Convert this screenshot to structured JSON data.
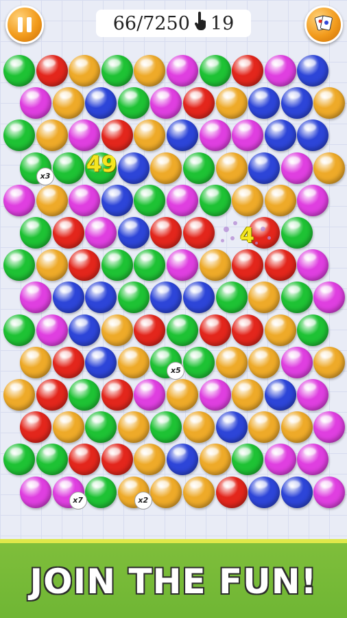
{
  "header": {
    "score": "66/7250",
    "moves": "19",
    "pause_icon": "pause-icon",
    "menu_icon": "cards-menu-icon",
    "hand_icon": "pointing-hand-icon"
  },
  "colors": {
    "G": "#1ec234",
    "R": "#e3261c",
    "O": "#eeaa29",
    "M": "#df3fe0",
    "B": "#2d45d8"
  },
  "board": {
    "rows": [
      "GROGOMGRMB",
      "MOBGMROBBO",
      "GOMROBMMBB",
      "GGGBOGOBMO",
      "MOMBGMGOOM",
      "GRMBRR.RG",
      "GORGGMORRM",
      "MBBGBBGOGM",
      "GMBORGRROG",
      "ORBOGGOOMO",
      "ORGRMOMOBM",
      "ROGOGOBOOM",
      "GGRROBOGMM",
      "MMGOOORBBM"
    ],
    "badges": [
      {
        "row": 3,
        "col": 0,
        "text": "x3"
      },
      {
        "row": 9,
        "col": 4,
        "text": "x5"
      },
      {
        "row": 13,
        "col": 1,
        "text": "x7"
      },
      {
        "row": 13,
        "col": 3,
        "text": "x2"
      }
    ]
  },
  "popups": {
    "points_big": "49",
    "points_small": "4"
  },
  "banner": {
    "text": "JOIN THE FUN!"
  }
}
